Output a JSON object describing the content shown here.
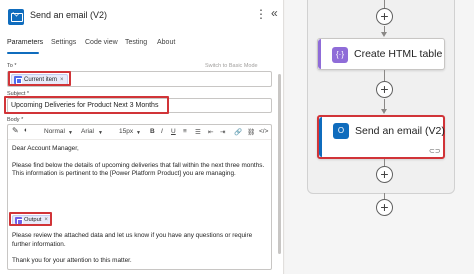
{
  "header": {
    "title": "Send an email (V2)",
    "more_glyph": "⋮",
    "collapse_glyph": "«"
  },
  "tabs": [
    {
      "label": "Parameters",
      "active": true
    },
    {
      "label": "Settings",
      "active": false
    },
    {
      "label": "Code view",
      "active": false
    },
    {
      "label": "Testing",
      "active": false
    },
    {
      "label": "About",
      "active": false
    }
  ],
  "form": {
    "to_label": "To *",
    "to_token": "Current item",
    "switch_mode": "Switch to Basic Mode",
    "subject_label": "Subject *",
    "subject_value": "Upcoming Deliveries for Product Next 3 Months",
    "body_label": "Body *"
  },
  "toolbar": {
    "format": "Normal",
    "font": "Arial",
    "size": "15px"
  },
  "body": {
    "greeting": "Dear Account Manager,",
    "paragraph1": "Please find below the details of upcoming deliveries that fall within the next three months. This information is pertinent to the [Power Platform Product] you are managing.",
    "output_token": "Output",
    "paragraph2": "Please review the attached data and let us know if you have any questions or require further information.",
    "closing": "Thank you for your attention to this matter."
  },
  "canvas": {
    "card_html_table": "Create HTML table",
    "card_send_email": "Send an email (V2)"
  },
  "colors": {
    "accent": "#0f6cbd",
    "highlight": "#d13438",
    "data_operation": "#8f6cd8",
    "outlook": "#0f6cbd"
  },
  "icons": {
    "outlook": "outlook-icon",
    "data_operation": "data-operation-icon",
    "token": "token-icon",
    "link": "link-icon"
  }
}
